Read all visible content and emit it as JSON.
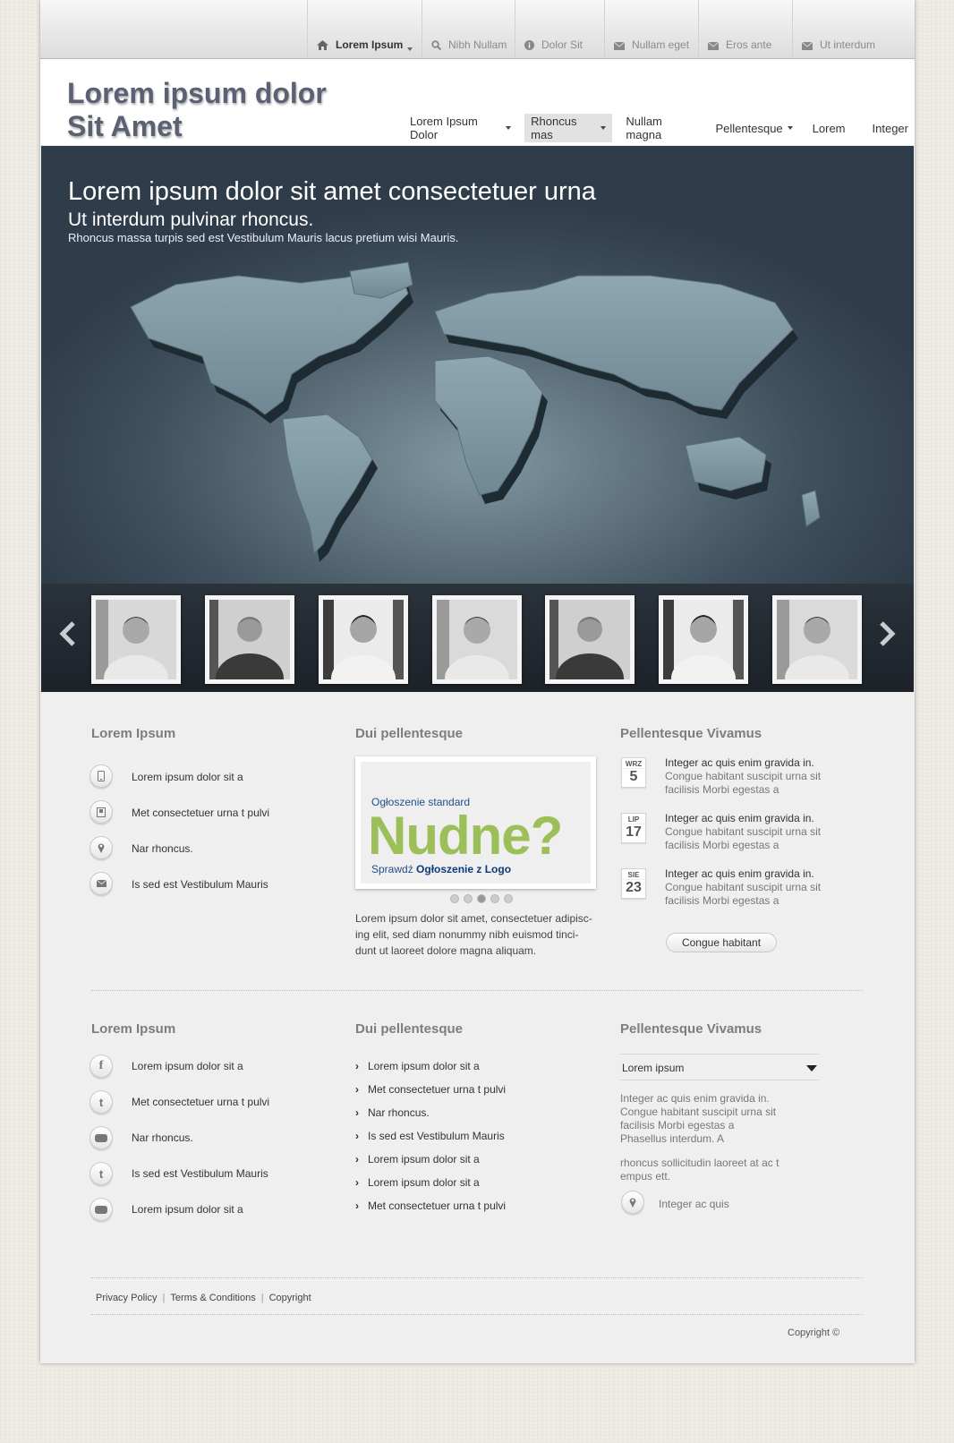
{
  "topnav": [
    {
      "label": "Lorem Ipsum",
      "icon": "home-icon",
      "active": true
    },
    {
      "label": "Nibh Nullam",
      "icon": "search-icon"
    },
    {
      "label": "Dolor Sit",
      "icon": "info-icon"
    },
    {
      "label": "Nullam eget",
      "icon": "mail-icon"
    },
    {
      "label": "Eros ante",
      "icon": "mail-icon"
    },
    {
      "label": "Ut interdum",
      "icon": "mail-icon"
    }
  ],
  "logo": {
    "line1": "Lorem ipsum dolor",
    "line2": "Sit Amet"
  },
  "mainnav": [
    {
      "label": "Lorem Ipsum Dolor",
      "dropdown": true
    },
    {
      "label": "Rhoncus mas",
      "dropdown": true,
      "active": true
    },
    {
      "label": "Nullam magna"
    },
    {
      "label": "Pellentesque",
      "dropdown": true
    },
    {
      "label": "Lorem"
    },
    {
      "label": "Integer"
    }
  ],
  "hero": {
    "title": "Lorem ipsum dolor sit amet consectetuer urna",
    "subtitle": "Ut interdum pulvinar rhoncus.",
    "text": "Rhoncus massa turpis sed est Vestibulum Mauris lacus pretium wisi Mauris."
  },
  "columns1": {
    "col1": {
      "title": "Lorem Ipsum",
      "items": [
        {
          "icon": "phone-icon",
          "label": "Lorem ipsum dolor sit a"
        },
        {
          "icon": "fax-icon",
          "label": "Met consectetuer urna t pulvi"
        },
        {
          "icon": "location-pin-icon",
          "label": "Nar rhoncus."
        },
        {
          "icon": "mail-icon",
          "label": "Is sed est Vestibulum Mauris"
        }
      ]
    },
    "col2": {
      "title": "Dui pellentesque",
      "ad": {
        "small": "Ogłoszenie standard",
        "big": "Nudne?",
        "cta_prefix": "Sprawdź",
        "cta_bold": "Ogłoszenie z Logo"
      },
      "paragraph": "Lorem ipsum dolor sit amet, consectetuer adipisc-ing elit, sed diam nonummy nibh euismod tinci-dunt ut laoreet dolore magna aliquam."
    },
    "col3": {
      "title": "Pellentesque Vivamus",
      "news": [
        {
          "month": "WRZ",
          "day": "5",
          "title": "Integer ac quis enim gravida in.",
          "body": "Congue habitant suscipit urna sit facilisis Morbi egestas a"
        },
        {
          "month": "LIP",
          "day": "17",
          "title": "Integer ac quis enim gravida in.",
          "body": "Congue habitant suscipit urna sit facilisis Morbi egestas a"
        },
        {
          "month": "SIE",
          "day": "23",
          "title": "Integer ac quis enim gravida in.",
          "body": "Congue habitant suscipit urna sit facilisis Morbi egestas a"
        }
      ],
      "button": "Congue habitant"
    }
  },
  "columns2": {
    "col1": {
      "title": "Lorem Ipsum",
      "items": [
        {
          "icon": "facebook-icon",
          "label": "Lorem ipsum dolor sit a"
        },
        {
          "icon": "twitter-icon",
          "label": "Met consectetuer urna t pulvi"
        },
        {
          "icon": "youtube-icon",
          "label": "Nar rhoncus."
        },
        {
          "icon": "twitter-icon",
          "label": "Is sed est Vestibulum Mauris"
        },
        {
          "icon": "youtube-icon",
          "label": "Lorem ipsum dolor sit a"
        }
      ]
    },
    "col2": {
      "title": "Dui pellentesque",
      "links": [
        "Lorem ipsum dolor sit a",
        "Met consectetuer urna t pulvi",
        "Nar rhoncus.",
        "Is sed est Vestibulum Mauris",
        "Lorem ipsum dolor sit a",
        "Lorem ipsum dolor sit a",
        "Met consectetuer urna t pulvi"
      ]
    },
    "col3": {
      "title": "Pellentesque Vivamus",
      "select_value": "Lorem ipsum",
      "text1": "Integer ac quis enim gravida in. Congue habitant suscipit urna sit facilisis Morbi egestas a Phasellus interdum. A",
      "text2": "rhoncus sollicitudin laoreet at ac t empus ett.",
      "location": "Integer ac quis"
    }
  },
  "footer": {
    "links": [
      "Privacy Policy",
      "Terms & Conditions",
      "Copyright"
    ],
    "copyright": "Copyright ©"
  }
}
